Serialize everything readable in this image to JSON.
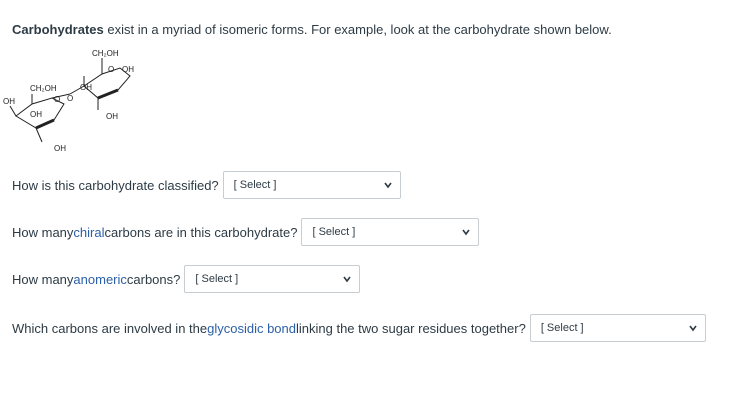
{
  "intro": {
    "bold": "Carbohydrates",
    "rest": " exist in a myriad of isomeric forms. For example, look at the carbohydrate shown below."
  },
  "molecule": {
    "labels": {
      "ch2oh_top": "CH₂OH",
      "o_right": "O",
      "oh_right_top": "OH",
      "ch2oh_left": "CH₂OH",
      "oh_ring_right": "OH",
      "oh_far_left": "OH",
      "o_left_ring": "O",
      "o_bridge": "O",
      "oh_left_inner": "OH",
      "oh_right_bottom": "OH",
      "oh_left_bottom": "OH"
    }
  },
  "questions": [
    {
      "pre": "How is this carbohydrate classified?",
      "link": "",
      "post": "",
      "select_value": "[ Select ]"
    },
    {
      "pre": "How many ",
      "link": "chiral",
      "post": " carbons are in this carbohydrate?",
      "select_value": "[ Select ]"
    },
    {
      "pre": "How many ",
      "link": "anomeric",
      "post": " carbons?",
      "select_value": "[ Select ]"
    },
    {
      "pre": "Which carbons are involved in the ",
      "link": "glycosidic bond",
      "post": " linking the two sugar residues together?",
      "select_value": "[ Select ]"
    }
  ],
  "colors": {
    "text": "#2d3b45",
    "link": "#2b5fa8",
    "select_border": "#c7cdd1"
  }
}
